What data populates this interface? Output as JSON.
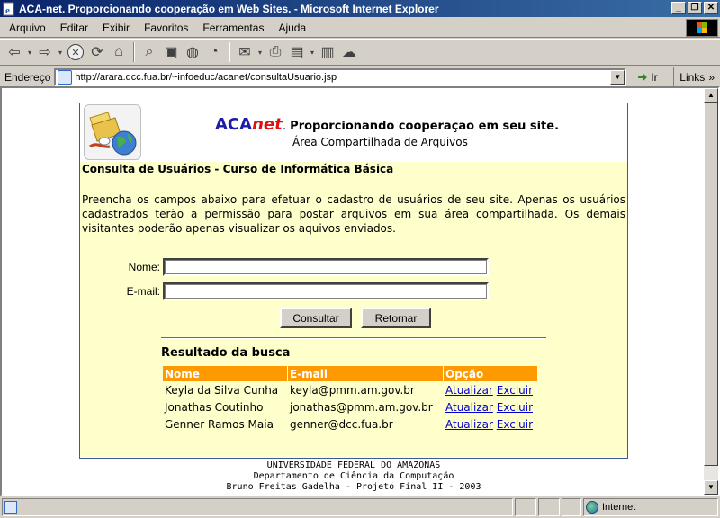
{
  "window": {
    "title": "ACA-net. Proporcionando cooperação em Web Sites. - Microsoft Internet Explorer",
    "controls": [
      "_",
      "❐",
      "✕"
    ]
  },
  "menubar": {
    "items": [
      "Arquivo",
      "Editar",
      "Exibir",
      "Favoritos",
      "Ferramentas",
      "Ajuda"
    ]
  },
  "toolbar": {
    "buttons": [
      "back-icon",
      "forward-icon",
      "stop-icon",
      "refresh-icon",
      "home-icon",
      "search-icon",
      "favorites-icon",
      "media-icon",
      "history-icon",
      "mail-icon",
      "print-icon",
      "edit-icon",
      "discuss-icon",
      "messenger-icon"
    ]
  },
  "address": {
    "label": "Endereço",
    "url": "http://arara.dcc.fua.br/~infoeduc/acanet/consultaUsuario.jsp",
    "go_label": "Ir",
    "links_label": "Links"
  },
  "header": {
    "brand_aca": "ACA",
    "brand_net": "net",
    "brand_dot": ".",
    "tagline": "Proporcionando cooperação em seu site.",
    "subtitle": "Área Compartilhada de Arquivos"
  },
  "content": {
    "title": "Consulta de Usuários - Curso de Informática Básica",
    "intro": "Preencha os campos abaixo para efetuar o cadastro de usuários de seu site. Apenas os usuários cadastrados terão a permissão para postar arquivos em sua área compartilhada. Os demais visitantes poderão apenas visualizar os aquivos enviados."
  },
  "form": {
    "name_label": "Nome:",
    "name_value": "",
    "email_label": "E-mail:",
    "email_value": "",
    "consult_button": "Consultar",
    "return_button": "Retornar"
  },
  "results": {
    "title": "Resultado da busca",
    "columns": [
      "Nome",
      "E-mail",
      "Opção"
    ],
    "rows": [
      {
        "name": "Keyla da Silva Cunha",
        "email": "keyla@pmm.am.gov.br",
        "update": "Atualizar",
        "delete": "Excluir"
      },
      {
        "name": "Jonathas Coutinho",
        "email": "jonathas@pmm.am.gov.br",
        "update": "Atualizar",
        "delete": "Excluir"
      },
      {
        "name": "Genner Ramos Maia",
        "email": "genner@dcc.fua.br",
        "update": "Atualizar",
        "delete": "Excluir"
      }
    ],
    "header_color": "#ff9900"
  },
  "footer": {
    "line1": "UNIVERSIDADE FEDERAL DO AMAZONAS",
    "line2": "Departamento de Ciência da Computação",
    "line3": "Bruno Freitas Gadelha - Projeto Final II - 2003"
  },
  "statusbar": {
    "status_text": "",
    "zone": "Internet"
  },
  "colors": {
    "page_background": "#ffffcc",
    "brand_blue": "#1c1ca8",
    "brand_red": "#e01010",
    "link": "#0000cc"
  }
}
